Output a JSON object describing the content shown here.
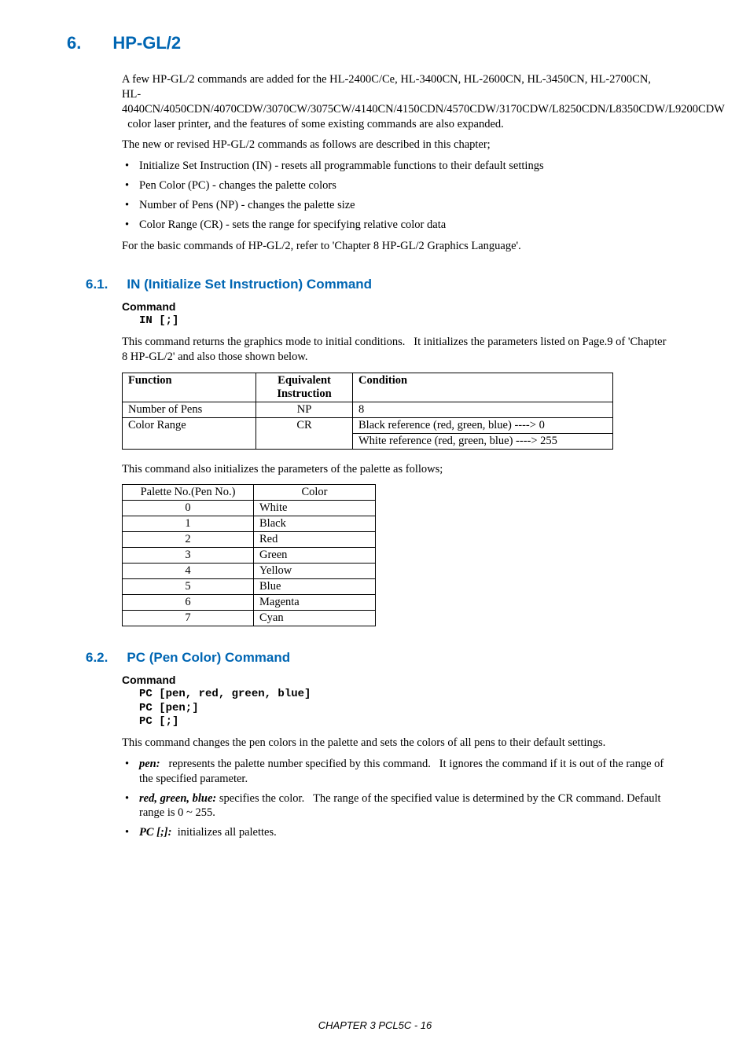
{
  "chapter": {
    "num": "6.",
    "title": "HP-GL/2"
  },
  "intro": {
    "p1": "A few HP-GL/2 commands are added for the HL-2400C/Ce, HL-3400CN, HL-2600CN, HL-3450CN, HL-2700CN, HL-4040CN/4050CDN/4070CDW/3070CW/3075CW/4140CN/4150CDN/4570CDW/3170CDW/L8250CDN/L8350CDW/L9200CDW   color laser printer, and the features of some existing commands are also expanded.",
    "p2": "The new or revised HP-GL/2 commands as follows are described in this chapter;",
    "bullets": [
      "Initialize Set Instruction (IN) - resets all programmable functions to their default settings",
      "Pen Color (PC) - changes the palette colors",
      "Number of Pens (NP) - changes the palette size",
      "Color Range (CR) - sets the range for specifying relative color data"
    ],
    "p3": "For the basic commands of HP-GL/2, refer to 'Chapter 8 HP-GL/2 Graphics Language'."
  },
  "s61": {
    "num": "6.1.",
    "title": "IN (Initialize Set Instruction) Command",
    "cmd_label": "Command",
    "code": "IN [;]",
    "p1": "This command returns the graphics mode to initial conditions.   It initializes the parameters listed on Page.9 of 'Chapter 8 HP-GL/2' and also those shown below.",
    "table1": {
      "h": [
        "Function",
        "Equivalent Instruction",
        "Condition"
      ],
      "r1": [
        "Number of Pens",
        "NP",
        "8"
      ],
      "r2col1": "Color Range",
      "r2col2": "CR",
      "r2col3a": "Black reference (red, green, blue) ----> 0",
      "r2col3b": "White reference (red, green, blue) ----> 255"
    },
    "p2": "This command also initializes the parameters of the palette as follows;",
    "table2": {
      "h": [
        "Palette No.(Pen No.)",
        "Color"
      ],
      "rows": [
        [
          "0",
          "White"
        ],
        [
          "1",
          "Black"
        ],
        [
          "2",
          "Red"
        ],
        [
          "3",
          "Green"
        ],
        [
          "4",
          "Yellow"
        ],
        [
          "5",
          "Blue"
        ],
        [
          "6",
          "Magenta"
        ],
        [
          "7",
          "Cyan"
        ]
      ]
    }
  },
  "s62": {
    "num": "6.2.",
    "title": "PC (Pen Color) Command",
    "cmd_label": "Command",
    "code": "PC [pen, red, green, blue]\nPC [pen;]\nPC [;]",
    "p1": "This command changes the pen colors in the palette and sets the colors of all pens to their default settings.",
    "bullets": [
      {
        "term": "pen:",
        "text": "   represents the palette number specified by this command.   It ignores the command if it is out of the range of the specified parameter."
      },
      {
        "term": "red, green, blue:",
        "text": " specifies the color.   The range of the specified value is determined by the CR command. Default range is 0 ~ 255."
      },
      {
        "term": "PC [;]:",
        "text": "  initializes all palettes."
      }
    ]
  },
  "footer": "CHAPTER 3 PCL5C - 16"
}
